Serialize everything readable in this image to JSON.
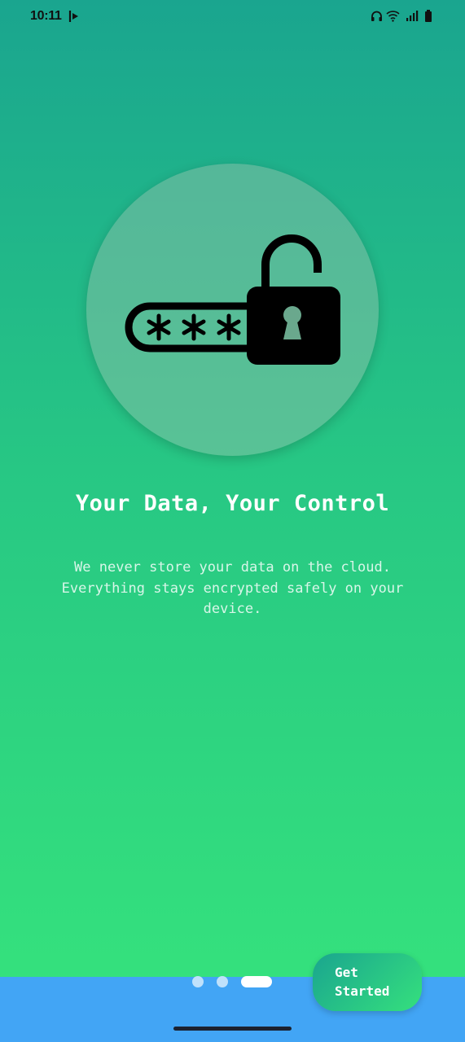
{
  "status_bar": {
    "time": "10:11",
    "icons": [
      "notification-app-icon",
      "headphones-icon",
      "wifi-icon",
      "signal-icon",
      "battery-icon"
    ]
  },
  "onboarding": {
    "illustration": "password-unlocked-padlock-icon",
    "title": "Your Data, Your Control",
    "description": "We never store your data on the cloud. Everything stays encrypted safely on your device.",
    "page_indicator": {
      "total": 3,
      "current": 3
    },
    "cta_label": "Get\nStarted"
  },
  "colors": {
    "gradient_top": "#1aa58f",
    "gradient_bottom": "#36e47c",
    "bottom_bar": "#42a5f5",
    "text": "#ffffff"
  }
}
